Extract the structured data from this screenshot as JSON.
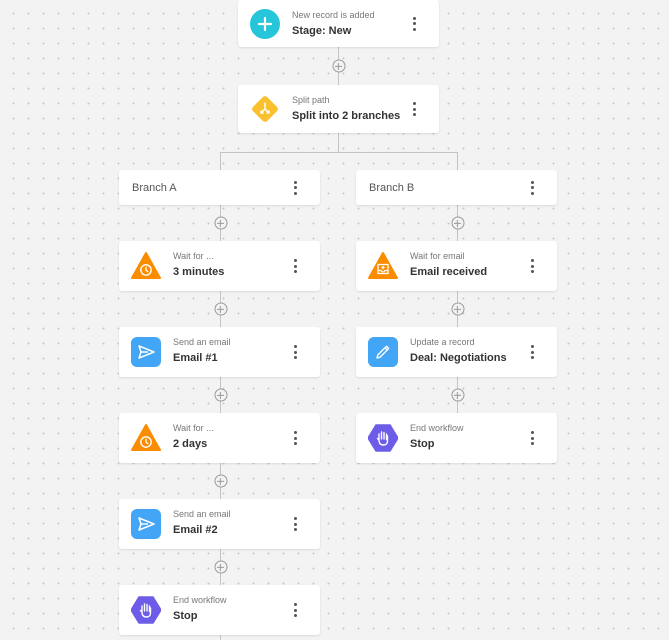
{
  "trigger": {
    "subtitle": "New record is added",
    "title": "Stage: New",
    "icon": "plus-icon",
    "color": "#26c6da"
  },
  "split": {
    "subtitle": "Split path",
    "title": "Split into 2 branches",
    "icon": "split-icon",
    "color": "#fbc02d"
  },
  "branches": [
    {
      "label": "Branch A",
      "steps": [
        {
          "subtitle": "Wait for ...",
          "title": "3 minutes",
          "icon": "clock-icon",
          "color": "#fb8c00"
        },
        {
          "subtitle": "Send an email",
          "title": "Email #1",
          "icon": "send-icon",
          "color": "#42a5f5"
        },
        {
          "subtitle": "Wait for ...",
          "title": "2 days",
          "icon": "clock-icon",
          "color": "#fb8c00"
        },
        {
          "subtitle": "Send an email",
          "title": "Email #2",
          "icon": "send-icon",
          "color": "#42a5f5"
        },
        {
          "subtitle": "End workflow",
          "title": "Stop",
          "icon": "hand-stop-icon",
          "color": "#6c5ce7"
        }
      ]
    },
    {
      "label": "Branch B",
      "steps": [
        {
          "subtitle": "Wait for email",
          "title": "Email received",
          "icon": "inbox-icon",
          "color": "#fb8c00"
        },
        {
          "subtitle": "Update a record",
          "title": "Deal: Negotiations",
          "icon": "pencil-icon",
          "color": "#42a5f5"
        },
        {
          "subtitle": "End workflow",
          "title": "Stop",
          "icon": "hand-stop-icon",
          "color": "#6c5ce7"
        }
      ]
    }
  ]
}
